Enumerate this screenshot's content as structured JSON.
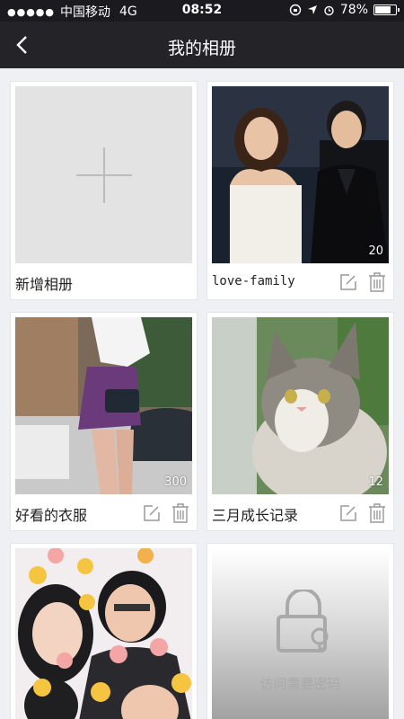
{
  "status_bar": {
    "signal": "●●●●●",
    "carrier": "中国移动",
    "network": "4G",
    "time": "08:52",
    "battery": "78%",
    "battery_level": 0.78
  },
  "nav": {
    "title": "我的相册"
  },
  "albums": [
    {
      "name": "新增相册",
      "type": "add"
    },
    {
      "name": "love-family",
      "count": "20",
      "type": "photo"
    },
    {
      "name": "好看的衣服",
      "count": "300",
      "type": "photo"
    },
    {
      "name": "三月成长记录",
      "count": "12",
      "type": "photo"
    },
    {
      "name": "",
      "type": "photo"
    },
    {
      "lock_text": "访问需要密码",
      "type": "locked"
    }
  ],
  "icons": {
    "back": "back-chevron-icon",
    "edit": "edit-icon",
    "delete": "trash-icon",
    "add": "plus-icon",
    "lock": "lock-icon"
  },
  "colors": {
    "nav_bg": "#232328",
    "page_bg": "#eef0f4",
    "add_bg": "#e3e3e3"
  }
}
